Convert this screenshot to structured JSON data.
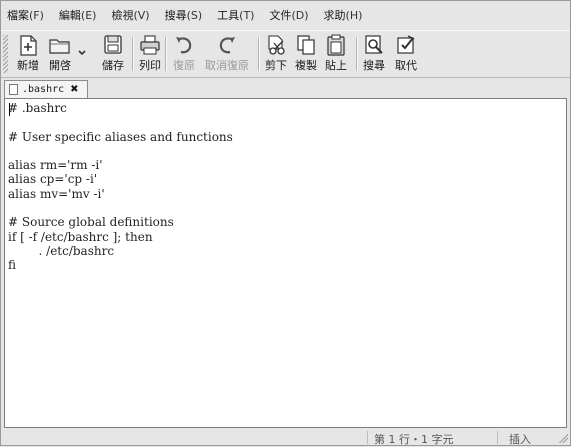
{
  "menubar": {
    "items": [
      {
        "label": "檔案",
        "mnemonic": "(F)"
      },
      {
        "label": "編輯",
        "mnemonic": "(E)"
      },
      {
        "label": "檢視",
        "mnemonic": "(V)"
      },
      {
        "label": "搜尋",
        "mnemonic": "(S)"
      },
      {
        "label": "工具",
        "mnemonic": "(T)"
      },
      {
        "label": "文件",
        "mnemonic": "(D)"
      },
      {
        "label": "求助",
        "mnemonic": "(H)"
      }
    ]
  },
  "toolbar": {
    "new": "新增",
    "open": "開啓",
    "save": "儲存",
    "print": "列印",
    "undo": "復原",
    "redo": "取消復原",
    "cut": "剪下",
    "copy": "複製",
    "paste": "貼上",
    "find": "搜尋",
    "replace": "取代"
  },
  "tab": {
    "label": ".bashrc",
    "close": "✖"
  },
  "editor": {
    "content": "# .bashrc\n\n# User specific aliases and functions\n\nalias rm='rm -i'\nalias cp='cp -i'\nalias mv='mv -i'\n\n# Source global definitions\nif [ -f /etc/bashrc ]; then\n        . /etc/bashrc\nfi"
  },
  "statusbar": {
    "position": "第 1 行・1 字元",
    "mode": "插入"
  }
}
